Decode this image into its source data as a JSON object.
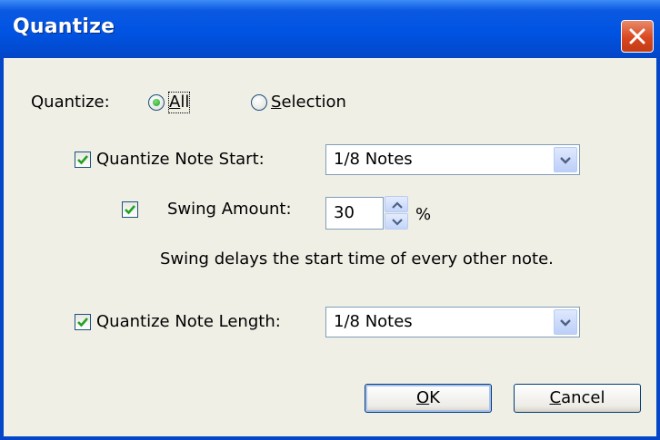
{
  "window": {
    "title": "Quantize"
  },
  "quantize_scope": {
    "label": "Quantize:",
    "options": [
      {
        "label": "All",
        "accel": "A",
        "rest": "ll",
        "selected": true
      },
      {
        "label": "Selection",
        "accel": "S",
        "rest": "election",
        "selected": false
      }
    ]
  },
  "note_start": {
    "label": "Quantize Note Start:",
    "checked": true,
    "value": "1/8 Notes"
  },
  "swing": {
    "label": "Swing Amount:",
    "checked": true,
    "value": "30",
    "unit": "%",
    "description": "Swing delays the start time of every other note."
  },
  "note_length": {
    "label": "Quantize Note Length:",
    "checked": true,
    "value": "1/8 Notes"
  },
  "buttons": {
    "ok": {
      "label": "OK",
      "accel": "O",
      "rest": "K"
    },
    "cancel": {
      "label": "Cancel",
      "accel": "C",
      "rest": "ancel"
    }
  },
  "colors": {
    "titlebar": "#0054e3",
    "close": "#d9471f",
    "dialog_bg": "#f0efe6",
    "check_mark": "#21a121"
  },
  "icons": {
    "close": "close-icon",
    "dropdown": "chevron-down-icon",
    "spin_up": "arrow-up-icon",
    "spin_down": "arrow-down-icon"
  }
}
